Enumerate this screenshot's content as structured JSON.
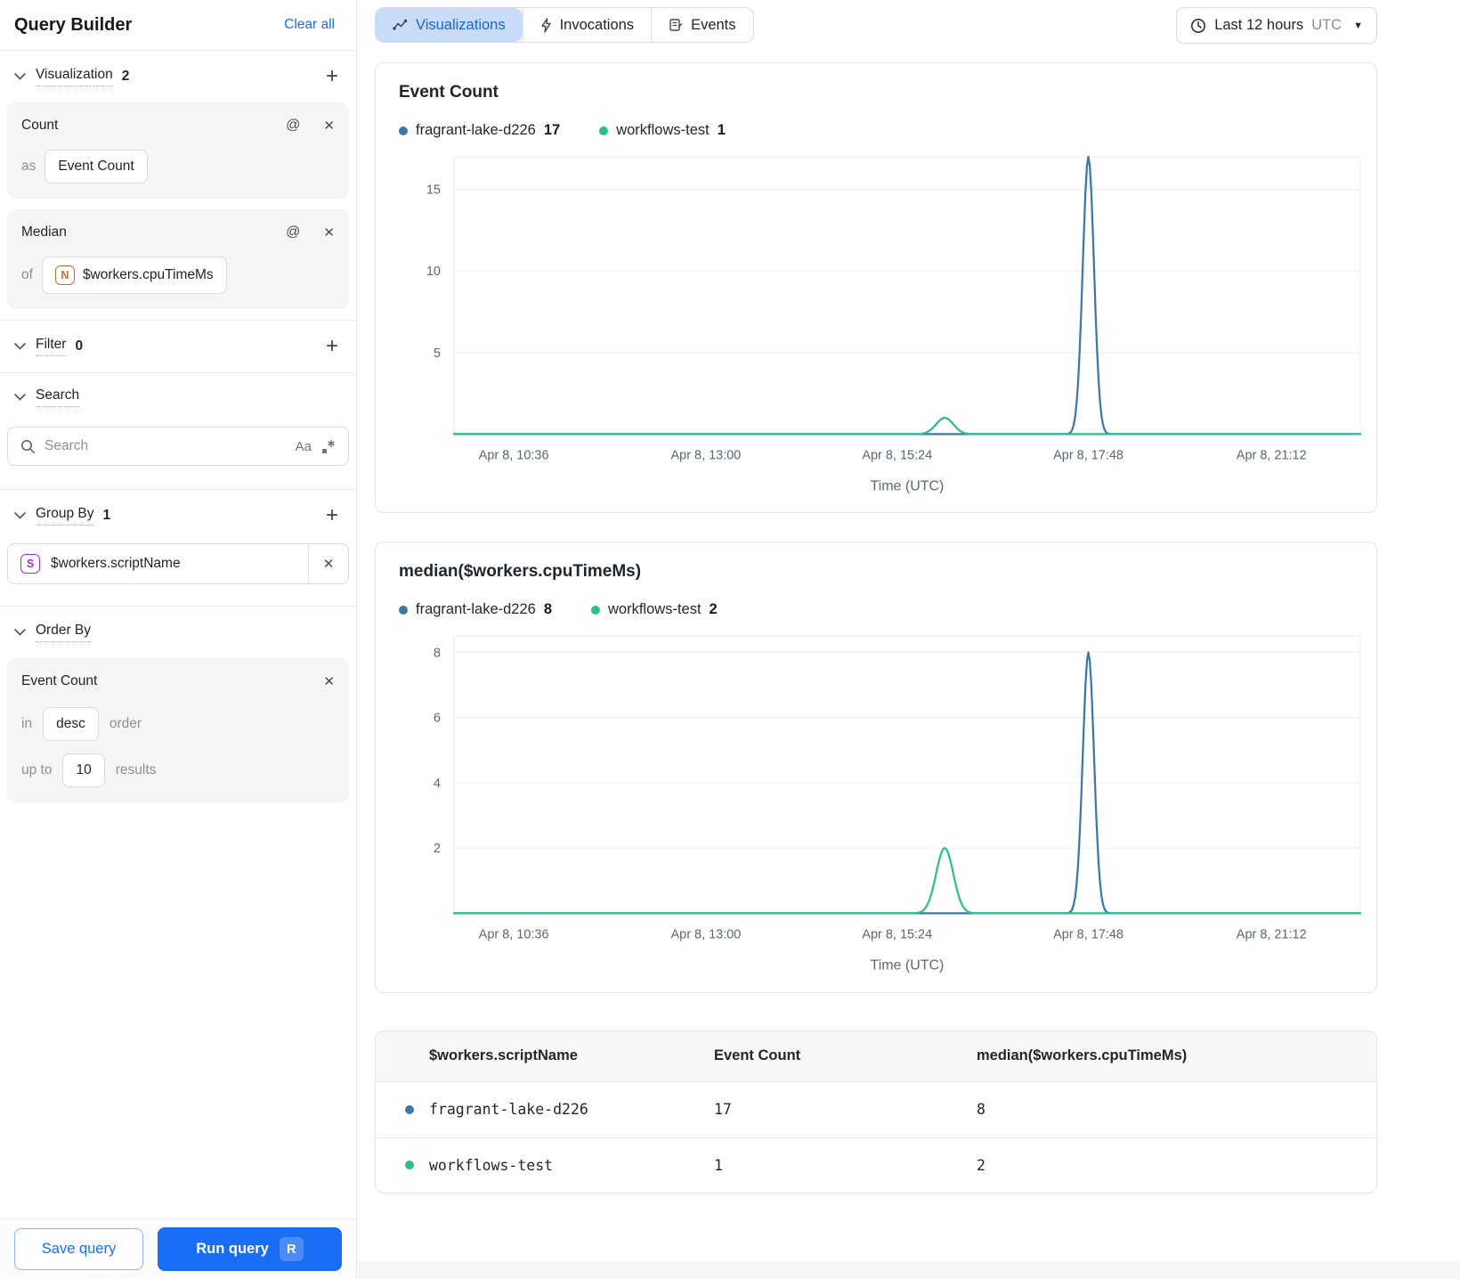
{
  "sidebar": {
    "title": "Query Builder",
    "clear_all": "Clear all",
    "visualization": {
      "label": "Visualization",
      "count": "2",
      "cards": [
        {
          "title": "Count",
          "prefix": "as",
          "value": "Event Count"
        },
        {
          "title": "Median",
          "prefix": "of",
          "badge": "N",
          "value": "$workers.cpuTimeMs"
        }
      ]
    },
    "filter": {
      "label": "Filter",
      "count": "0"
    },
    "search": {
      "label": "Search",
      "placeholder": "Search",
      "match_case": "Aa"
    },
    "group_by": {
      "label": "Group By",
      "count": "1",
      "badge": "S",
      "value": "$workers.scriptName"
    },
    "order_by": {
      "label": "Order By",
      "field": "Event Count",
      "in_label": "in",
      "direction": "desc",
      "order_label": "order",
      "up_to_label": "up to",
      "limit": "10",
      "results_label": "results"
    },
    "save_button": "Save query",
    "run_button": "Run query",
    "run_shortcut": "R"
  },
  "header": {
    "tabs": [
      {
        "label": "Visualizations",
        "active": true
      },
      {
        "label": "Invocations",
        "active": false
      },
      {
        "label": "Events",
        "active": false
      }
    ],
    "time_range": {
      "label": "Last 12 hours",
      "zone": "UTC"
    }
  },
  "chart_data": [
    {
      "type": "line",
      "title": "Event Count",
      "xlabel": "Time (UTC)",
      "ylim": [
        0,
        17
      ],
      "y_ticks": [
        5,
        10,
        15
      ],
      "grid": true,
      "legend_position": "top",
      "x_ticks": [
        {
          "label": "Apr 8, 10:36",
          "f": 0.066
        },
        {
          "label": "Apr 8, 13:00",
          "f": 0.278
        },
        {
          "label": "Apr 8, 15:24",
          "f": 0.489
        },
        {
          "label": "Apr 8, 17:48",
          "f": 0.7
        },
        {
          "label": "Apr 8, 21:12",
          "f": 0.902
        }
      ],
      "series": [
        {
          "name": "fragrant-lake-d226",
          "total": 17,
          "color": "#3b78a8",
          "baseline": 0,
          "spikes": [
            {
              "at": 0.7,
              "height": 17,
              "sigma": 0.0062
            }
          ]
        },
        {
          "name": "workflows-test",
          "total": 1,
          "color": "#2fbd8d",
          "baseline": 0,
          "spikes": [
            {
              "at": 0.5415,
              "height": 1,
              "sigma": 0.0095
            }
          ]
        }
      ]
    },
    {
      "type": "line",
      "title": "median($workers.cpuTimeMs)",
      "xlabel": "Time (UTC)",
      "ylim": [
        0,
        8.5
      ],
      "y_ticks": [
        2,
        4,
        6,
        8
      ],
      "grid": true,
      "legend_position": "top",
      "x_ticks": [
        {
          "label": "Apr 8, 10:36",
          "f": 0.066
        },
        {
          "label": "Apr 8, 13:00",
          "f": 0.278
        },
        {
          "label": "Apr 8, 15:24",
          "f": 0.489
        },
        {
          "label": "Apr 8, 17:48",
          "f": 0.7
        },
        {
          "label": "Apr 8, 21:12",
          "f": 0.902
        }
      ],
      "series": [
        {
          "name": "fragrant-lake-d226",
          "total": 8,
          "color": "#3b78a8",
          "baseline": 0,
          "spikes": [
            {
              "at": 0.7,
              "height": 8,
              "sigma": 0.0062
            }
          ]
        },
        {
          "name": "workflows-test",
          "total": 2,
          "color": "#2fbd8d",
          "baseline": 0,
          "spikes": [
            {
              "at": 0.5415,
              "height": 2,
              "sigma": 0.0095
            }
          ]
        }
      ]
    }
  ],
  "table": {
    "columns": [
      "$workers.scriptName",
      "Event Count",
      "median($workers.cpuTimeMs)"
    ],
    "rows": [
      {
        "dot": "#3b78a8",
        "cells": [
          "fragrant-lake-d226",
          "17",
          "8"
        ]
      },
      {
        "dot": "#2fbd8d",
        "cells": [
          "workflows-test",
          "1",
          "2"
        ]
      }
    ]
  },
  "colors": {
    "accent": "#1a6ef5",
    "series_blue": "#3b78a8",
    "series_green": "#2fbd8d"
  }
}
